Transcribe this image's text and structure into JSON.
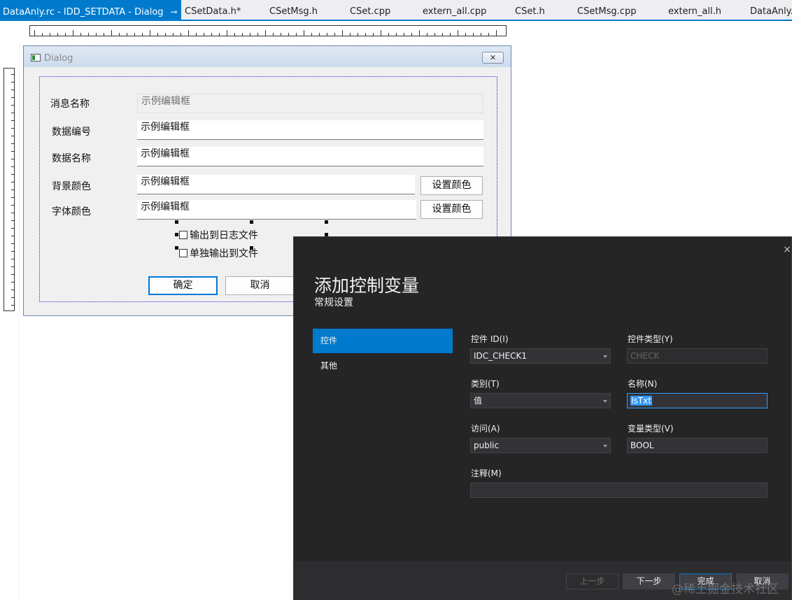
{
  "tabs": {
    "active": "DataAnly.rc - IDD_SETDATA - Dialog",
    "items": [
      "CSetData.h*",
      "CSetMsg.h",
      "CSet.cpp",
      "extern_all.cpp",
      "CSet.h",
      "CSetMsg.cpp",
      "extern_all.h",
      "DataAnly.cpp"
    ],
    "pin_icon": "⊸",
    "close_icon": "✕"
  },
  "dialog": {
    "title": "Dialog",
    "close_symbol": "✕",
    "fields": [
      {
        "label": "消息名称",
        "value": "示例编辑框"
      },
      {
        "label": "数据编号",
        "value": "示例编辑框"
      },
      {
        "label": "数据名称",
        "value": "示例编辑框"
      },
      {
        "label": "背景颜色",
        "value": "示例编辑框"
      },
      {
        "label": "字体颜色",
        "value": "示例编辑框"
      }
    ],
    "color_buttons": [
      "设置颜色",
      "设置颜色"
    ],
    "checkboxes": [
      "输出到日志文件",
      "单独输出到文件"
    ],
    "ok": "确定",
    "cancel": "取消"
  },
  "wizard": {
    "title": "添加控制变量",
    "subtitle": "常规设置",
    "close_symbol": "×",
    "nav": [
      "控件",
      "其他"
    ],
    "control_id_label": "控件 ID(I)",
    "control_id": "IDC_CHECK1",
    "control_type_label": "控件类型(Y)",
    "control_type": "CHECK",
    "category_label": "类别(T)",
    "category": "值",
    "name_label": "名称(N)",
    "name": "IsTxt",
    "access_label": "访问(A)",
    "access": "public",
    "var_type_label": "变量类型(V)",
    "var_type": "BOOL",
    "comment_label": "注释(M)",
    "comment": "",
    "prev": "上一步",
    "next": "下一步",
    "finish": "完成",
    "cancel": "取消",
    "accent": "#007acc"
  },
  "watermark": "@稀土掘金技术社区"
}
